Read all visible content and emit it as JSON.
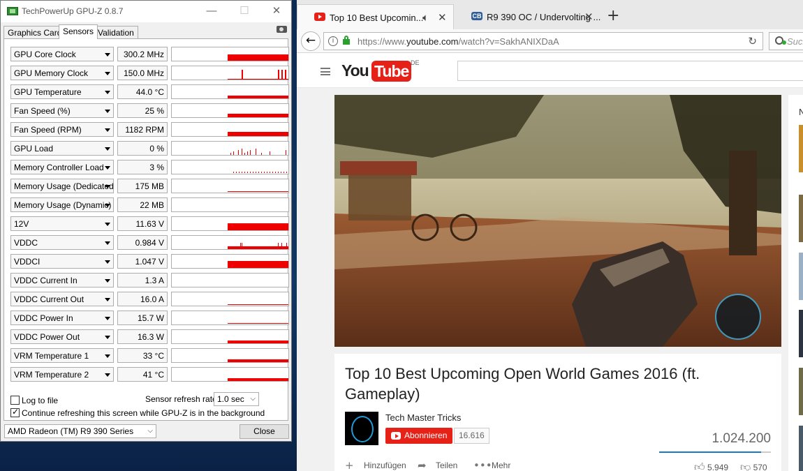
{
  "gpuz": {
    "title": "TechPowerUp GPU-Z 0.8.7",
    "tabs": [
      {
        "label": "Graphics Card"
      },
      {
        "label": "Sensors"
      },
      {
        "label": "Validation"
      }
    ],
    "sensors": [
      {
        "name": "GPU Core Clock",
        "value": "300.2 MHz"
      },
      {
        "name": "GPU Memory Clock",
        "value": "150.0 MHz"
      },
      {
        "name": "GPU Temperature",
        "value": "44.0 °C"
      },
      {
        "name": "Fan Speed (%)",
        "value": "25 %"
      },
      {
        "name": "Fan Speed (RPM)",
        "value": "1182 RPM"
      },
      {
        "name": "GPU Load",
        "value": "0 %"
      },
      {
        "name": "Memory Controller Load",
        "value": "3 %"
      },
      {
        "name": "Memory Usage (Dedicated)",
        "value": "175 MB"
      },
      {
        "name": "Memory Usage (Dynamic)",
        "value": "22 MB"
      },
      {
        "name": "12V",
        "value": "11.63 V"
      },
      {
        "name": "VDDC",
        "value": "0.984 V"
      },
      {
        "name": "VDDCI",
        "value": "1.047 V"
      },
      {
        "name": "VDDC Current In",
        "value": "1.3 A"
      },
      {
        "name": "VDDC Current Out",
        "value": "16.0 A"
      },
      {
        "name": "VDDC Power In",
        "value": "15.7 W"
      },
      {
        "name": "VDDC Power Out",
        "value": "16.3 W"
      },
      {
        "name": "VRM Temperature 1",
        "value": "33 °C"
      },
      {
        "name": "VRM Temperature 2",
        "value": "41 °C"
      }
    ],
    "log_to_file_label": "Log to file",
    "refresh_rate_label": "Sensor refresh rate:",
    "refresh_rate_value": "1.0 sec",
    "continue_refresh_label": "Continue refreshing this screen while GPU-Z is in the background",
    "gpu_select_value": "AMD Radeon (TM) R9 390 Series",
    "close_label": "Close",
    "graph_color": "#ee0000"
  },
  "browser": {
    "tabs": [
      {
        "label": "Top 10 Best Upcomin..."
      },
      {
        "label": "R9 390 OC / Undervolting ..."
      }
    ],
    "url_prefix": "https://www.",
    "url_domain": "youtube.com",
    "url_path": "/watch?v=SakhANIXDaA",
    "search_placeholder": "Such",
    "youtube": {
      "logo_you": "You",
      "logo_tube": "Tube",
      "logo_region": "DE",
      "video_title": "Top 10 Best Upcoming Open World Games 2016 (ft. Gameplay)",
      "channel_name": "Tech Master Tricks",
      "subscribe_label": "Abonnieren",
      "subscriber_count": "16.616",
      "view_count": "1.024.200",
      "add_label": "Hinzufügen",
      "share_label": "Teilen",
      "more_label": "Mehr",
      "likes": "5.949",
      "dislikes": "570",
      "sidebar_heading": "N"
    }
  }
}
